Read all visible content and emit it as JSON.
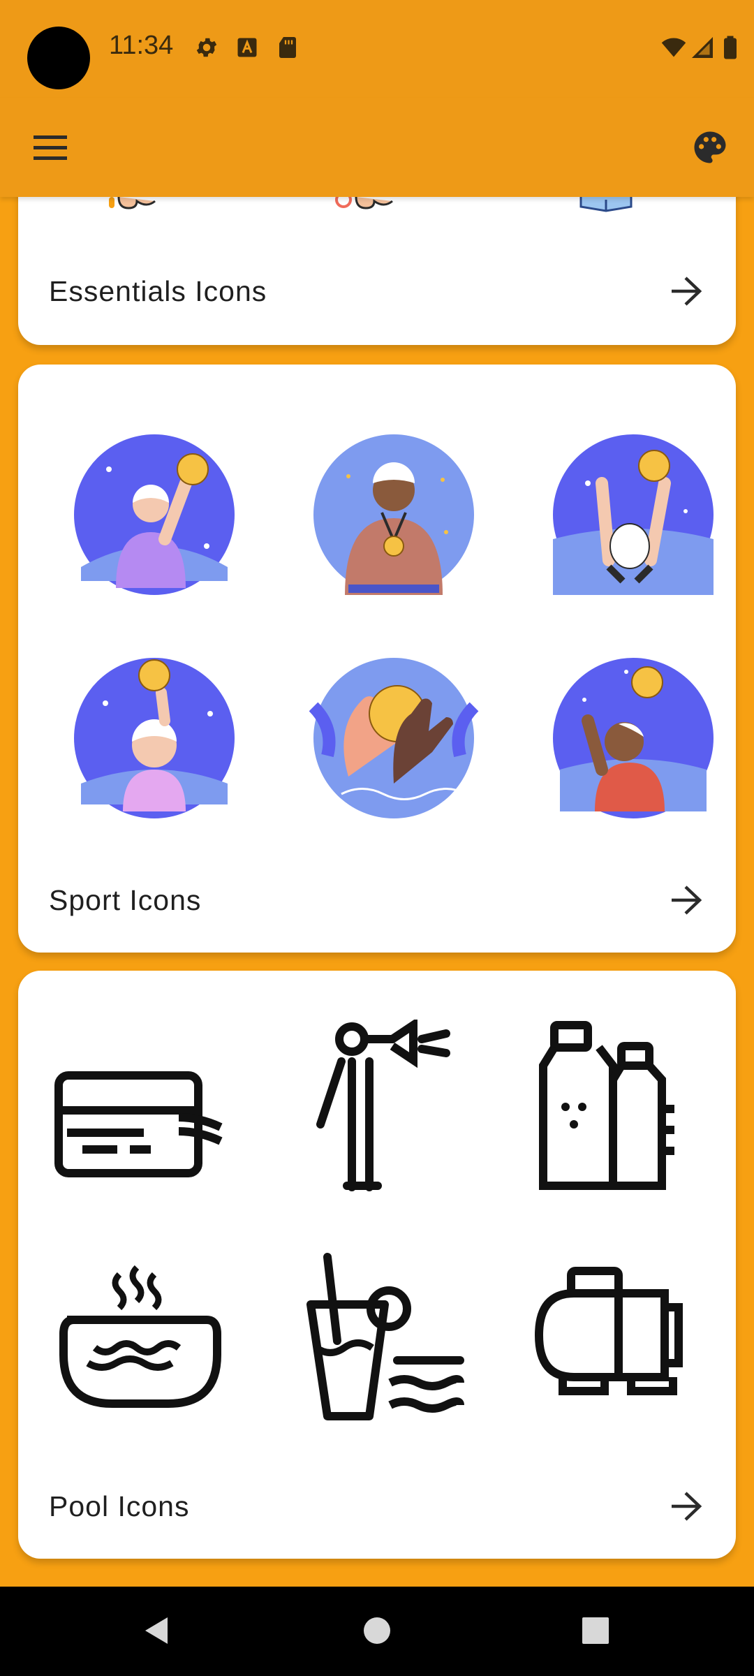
{
  "status_bar": {
    "time": "11:34",
    "left_icons": [
      "gear-icon",
      "font-a-icon",
      "sd-card-icon"
    ],
    "right_icons": [
      "wifi-icon",
      "signal-icon",
      "battery-icon"
    ]
  },
  "app_bar": {
    "menu_icon": "hamburger-menu-icon",
    "theme_icon": "palette-icon",
    "color": "#EE9A17"
  },
  "categories": [
    {
      "title": "Essentials Icons",
      "arrow_icon": "arrow-right-icon"
    },
    {
      "title": "Sport Icons",
      "arrow_icon": "arrow-right-icon",
      "icons": [
        "water-polo-player-throwing-icon",
        "medal-winner-icon",
        "player-jumping-icon",
        "player-holding-ball-icon",
        "hands-with-ball-icon",
        "player-raising-ball-icon"
      ]
    },
    {
      "title": "Pool Icons",
      "arrow_icon": "arrow-right-icon",
      "icons": [
        "pool-card-icon",
        "lifeguard-megaphone-icon",
        "sunscreen-bottles-icon",
        "hot-tub-icon",
        "drink-glass-icon",
        "pool-pump-icon"
      ]
    }
  ],
  "nav_bar": {
    "icons": [
      "back-triangle-icon",
      "home-circle-icon",
      "recents-square-icon"
    ]
  },
  "colors": {
    "background": "#F7A012",
    "card": "#FFFFFF",
    "sport_circle": "#5B5FF0",
    "sport_circle_light": "#7E9BEF"
  }
}
